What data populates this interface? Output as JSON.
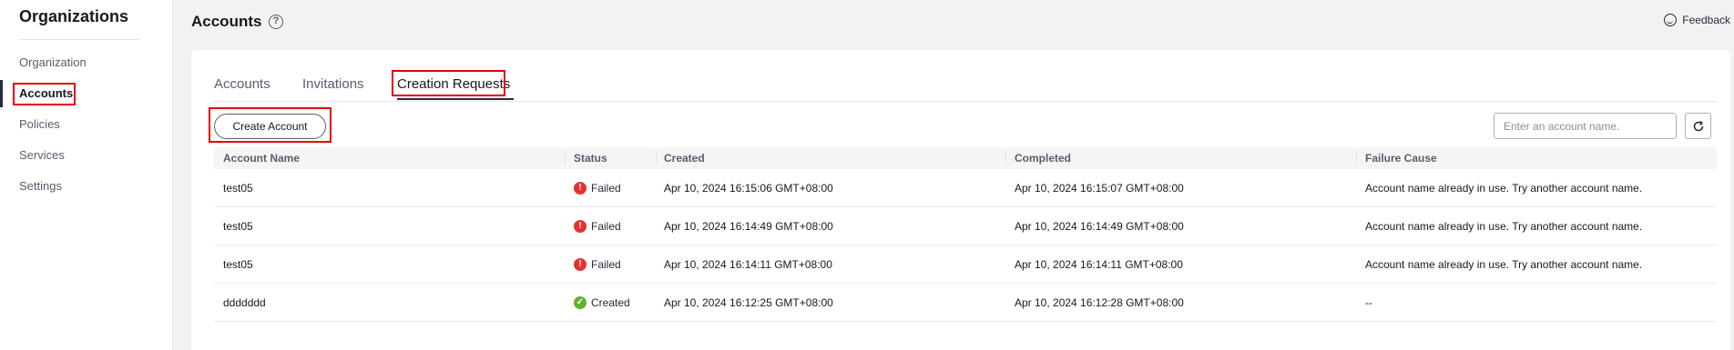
{
  "sidebar": {
    "title": "Organizations",
    "items": [
      {
        "label": "Organization"
      },
      {
        "label": "Accounts"
      },
      {
        "label": "Policies"
      },
      {
        "label": "Services"
      },
      {
        "label": "Settings"
      }
    ]
  },
  "header": {
    "title": "Accounts",
    "help_icon": "?",
    "feedback_label": "Feedback"
  },
  "tabs": [
    {
      "label": "Accounts"
    },
    {
      "label": "Invitations"
    },
    {
      "label": "Creation Requests"
    }
  ],
  "toolbar": {
    "create_label": "Create Account",
    "search_placeholder": "Enter an account name."
  },
  "table": {
    "columns": [
      "Account Name",
      "Status",
      "Created",
      "Completed",
      "Failure Cause"
    ],
    "rows": [
      {
        "name": "test05",
        "status": "Failed",
        "status_icon": "!",
        "created": "Apr 10, 2024 16:15:06 GMT+08:00",
        "completed": "Apr 10, 2024 16:15:07 GMT+08:00",
        "failure": "Account name already in use. Try another account name."
      },
      {
        "name": "test05",
        "status": "Failed",
        "status_icon": "!",
        "created": "Apr 10, 2024 16:14:49 GMT+08:00",
        "completed": "Apr 10, 2024 16:14:49 GMT+08:00",
        "failure": "Account name already in use. Try another account name."
      },
      {
        "name": "test05",
        "status": "Failed",
        "status_icon": "!",
        "created": "Apr 10, 2024 16:14:11 GMT+08:00",
        "completed": "Apr 10, 2024 16:14:11 GMT+08:00",
        "failure": "Account name already in use. Try another account name."
      },
      {
        "name": "ddddddd",
        "status": "Created",
        "status_icon": "✓",
        "created": "Apr 10, 2024 16:12:25 GMT+08:00",
        "completed": "Apr 10, 2024 16:12:28 GMT+08:00",
        "failure": "--"
      }
    ]
  },
  "colors": {
    "highlight": "#e60000",
    "failed": "#e7312f",
    "created": "#5fb12a"
  }
}
